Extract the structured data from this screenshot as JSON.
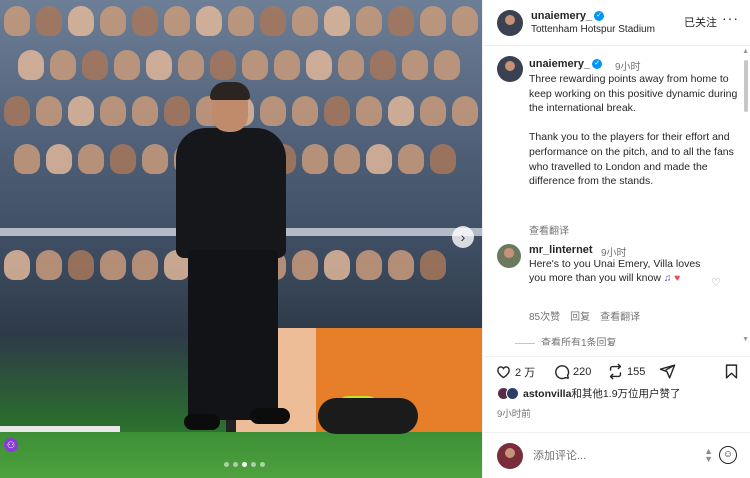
{
  "post": {
    "dots": 5,
    "active_dot": 3
  },
  "header": {
    "username": "unaiemery_",
    "location": "Tottenham Hotspur Stadium",
    "follow_label": "已关注",
    "more_label": "···"
  },
  "caption": {
    "username": "unaiemery_",
    "time": "9小时",
    "text": "Three rewarding points away from home to keep working on this positive dynamic during the international break.\n\nThank you to the players for their effort and performance on the pitch, and to all the fans who travelled to London and made the difference from the stands.",
    "translate_label": "查看翻译"
  },
  "comment": {
    "username": "mr_linternet",
    "time": "9小时",
    "text": "Here's to you Unai Emery, Villa loves you more than you will know",
    "likes": "85次赞",
    "reply_label": "回复",
    "translate_label": "查看翻译",
    "view_replies": "查看所有1条回复"
  },
  "actions": {
    "likes_count": "2 万",
    "comments_count": "220",
    "shares_count": "155"
  },
  "liked_by": {
    "text_bold": "astonvilla",
    "text_rest": "和其他1.9万位用户赞了"
  },
  "post_time": "9小时前",
  "composer": {
    "placeholder": "添加评论..."
  },
  "colors": {
    "verified": "#0095f6",
    "heart": "#ed4956",
    "board": "#e77f2a",
    "grass": "#4ea23f"
  }
}
